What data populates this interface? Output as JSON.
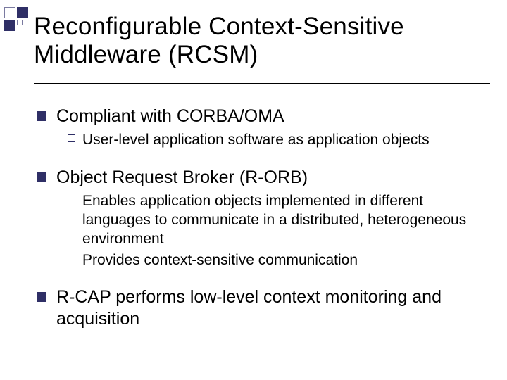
{
  "title": "Reconfigurable Context-Sensitive Middleware (RCSM)",
  "points": [
    {
      "text": "Compliant with CORBA/OMA",
      "sub": [
        "User-level application software as application objects"
      ]
    },
    {
      "text": "Object Request Broker (R-ORB)",
      "sub": [
        "Enables application objects implemented in different languages to communicate in a distributed, heterogeneous environment",
        "Provides context-sensitive communication"
      ]
    },
    {
      "text": "R-CAP performs low-level context monitoring and acquisition",
      "sub": []
    }
  ]
}
